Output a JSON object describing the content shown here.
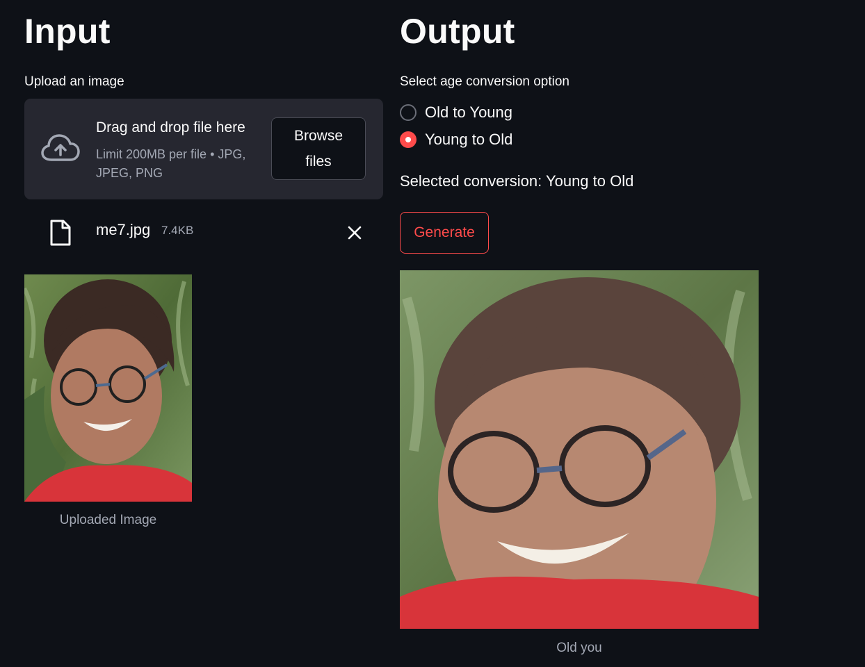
{
  "input": {
    "title": "Input",
    "upload_label": "Upload an image",
    "dropzone": {
      "title": "Drag and drop file here",
      "limit": "Limit 200MB per file • JPG, JPEG, PNG",
      "browse_label": "Browse files"
    },
    "file": {
      "name": "me7.jpg",
      "size": "7.4KB"
    },
    "image_caption": "Uploaded Image"
  },
  "output": {
    "title": "Output",
    "option_label": "Select age conversion option",
    "options": [
      {
        "label": "Old to Young",
        "selected": false
      },
      {
        "label": "Young to Old",
        "selected": true
      }
    ],
    "selected_text": "Selected conversion: Young to Old",
    "generate_label": "Generate",
    "image_caption": "Old you"
  },
  "colors": {
    "background": "#0e1117",
    "panel": "#262730",
    "accent": "#ff4b4b",
    "muted_text": "#a3a8b4"
  },
  "icons": [
    "cloud-upload-icon",
    "file-icon",
    "close-icon",
    "radio-icon"
  ]
}
